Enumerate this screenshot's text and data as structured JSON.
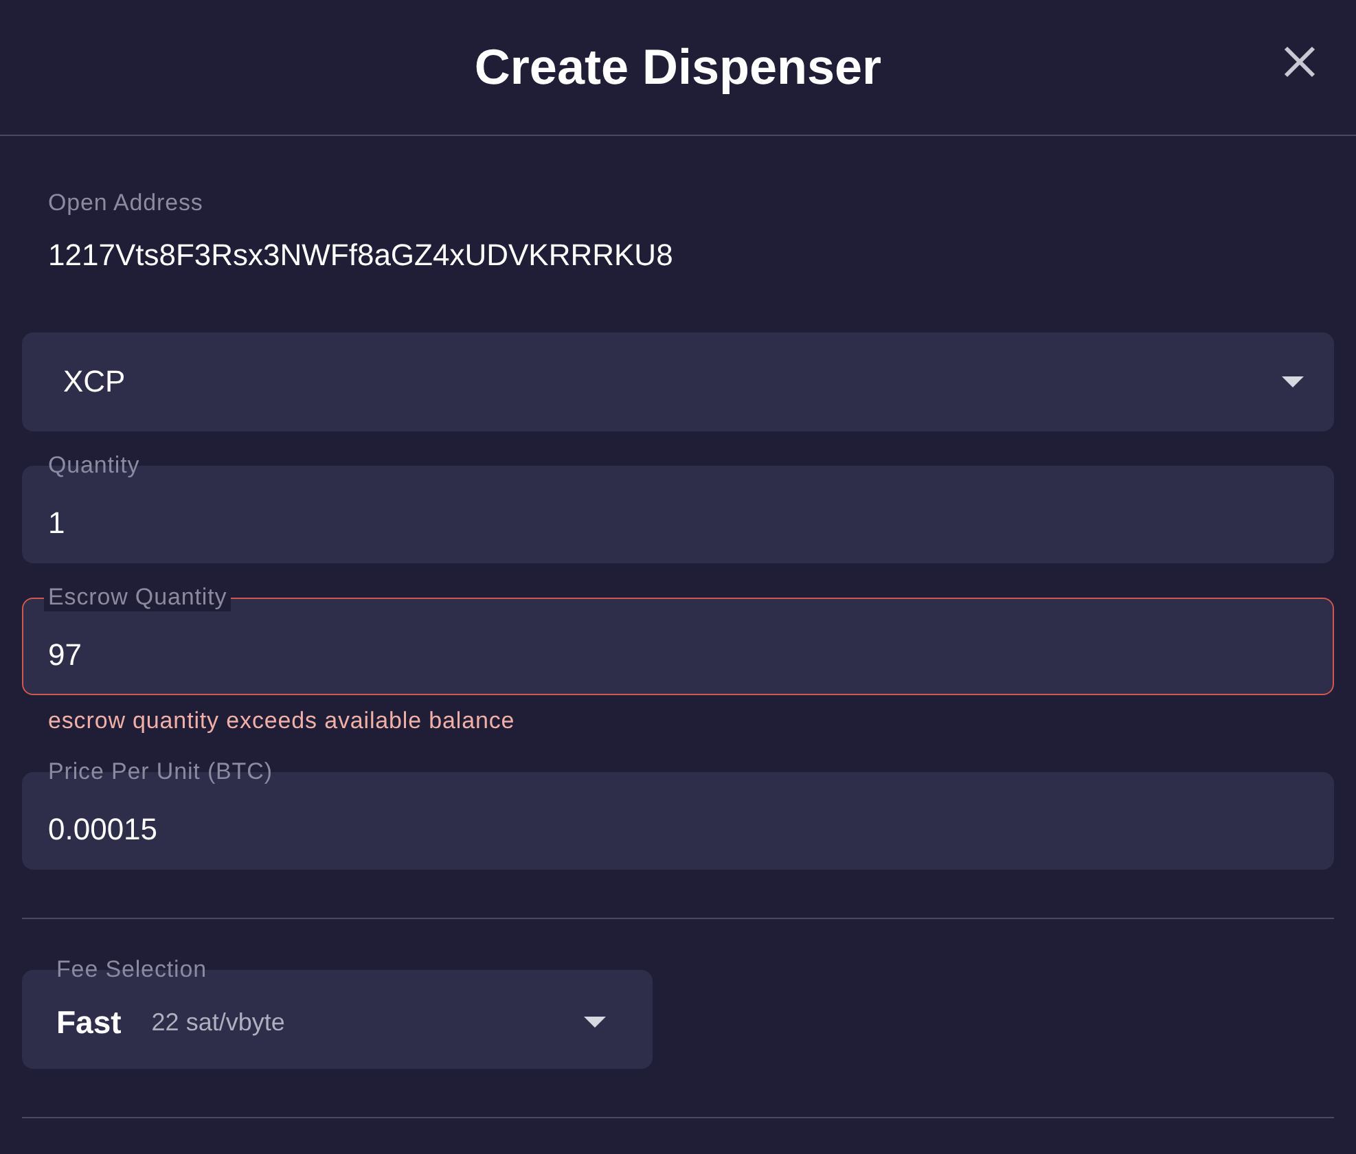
{
  "dialog": {
    "title": "Create Dispenser"
  },
  "open_address": {
    "label": "Open Address",
    "value": "1217Vts8F3Rsx3NWFf8aGZ4xUDVKRRRKU8"
  },
  "asset_select": {
    "value": "XCP"
  },
  "fields": [
    {
      "label": "Quantity",
      "value": "1",
      "error": false
    },
    {
      "label": "Escrow Quantity",
      "value": "97",
      "error": true,
      "error_message": "escrow quantity exceeds available balance"
    },
    {
      "label": "Price Per Unit (BTC)",
      "value": "0.00015",
      "error": false
    }
  ],
  "fee_select": {
    "label": "Fee Selection",
    "value": "Fast",
    "rate": "22 sat/vbyte"
  }
}
